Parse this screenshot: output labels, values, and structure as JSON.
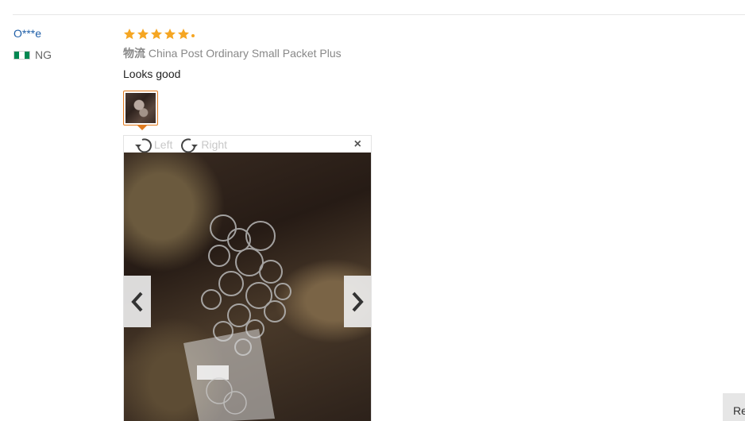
{
  "reviewer": {
    "name": "O***e",
    "country_code": "NG",
    "flag_colors": [
      "#008751",
      "#ffffff",
      "#008751"
    ]
  },
  "review": {
    "rating": 5,
    "star_color": "#f5a623",
    "logistics_label": "物流",
    "logistics_value": "China Post Ordinary Small Packet Plus",
    "text": "Looks good",
    "thumb_border_color": "#e07b1f"
  },
  "viewer": {
    "rotate_left_label": "Left",
    "rotate_right_label": "Right",
    "close_symbol": "×",
    "prev_icon": "chevron-left-icon",
    "next_icon": "chevron-right-icon"
  },
  "corner_button": {
    "label": "Re"
  }
}
